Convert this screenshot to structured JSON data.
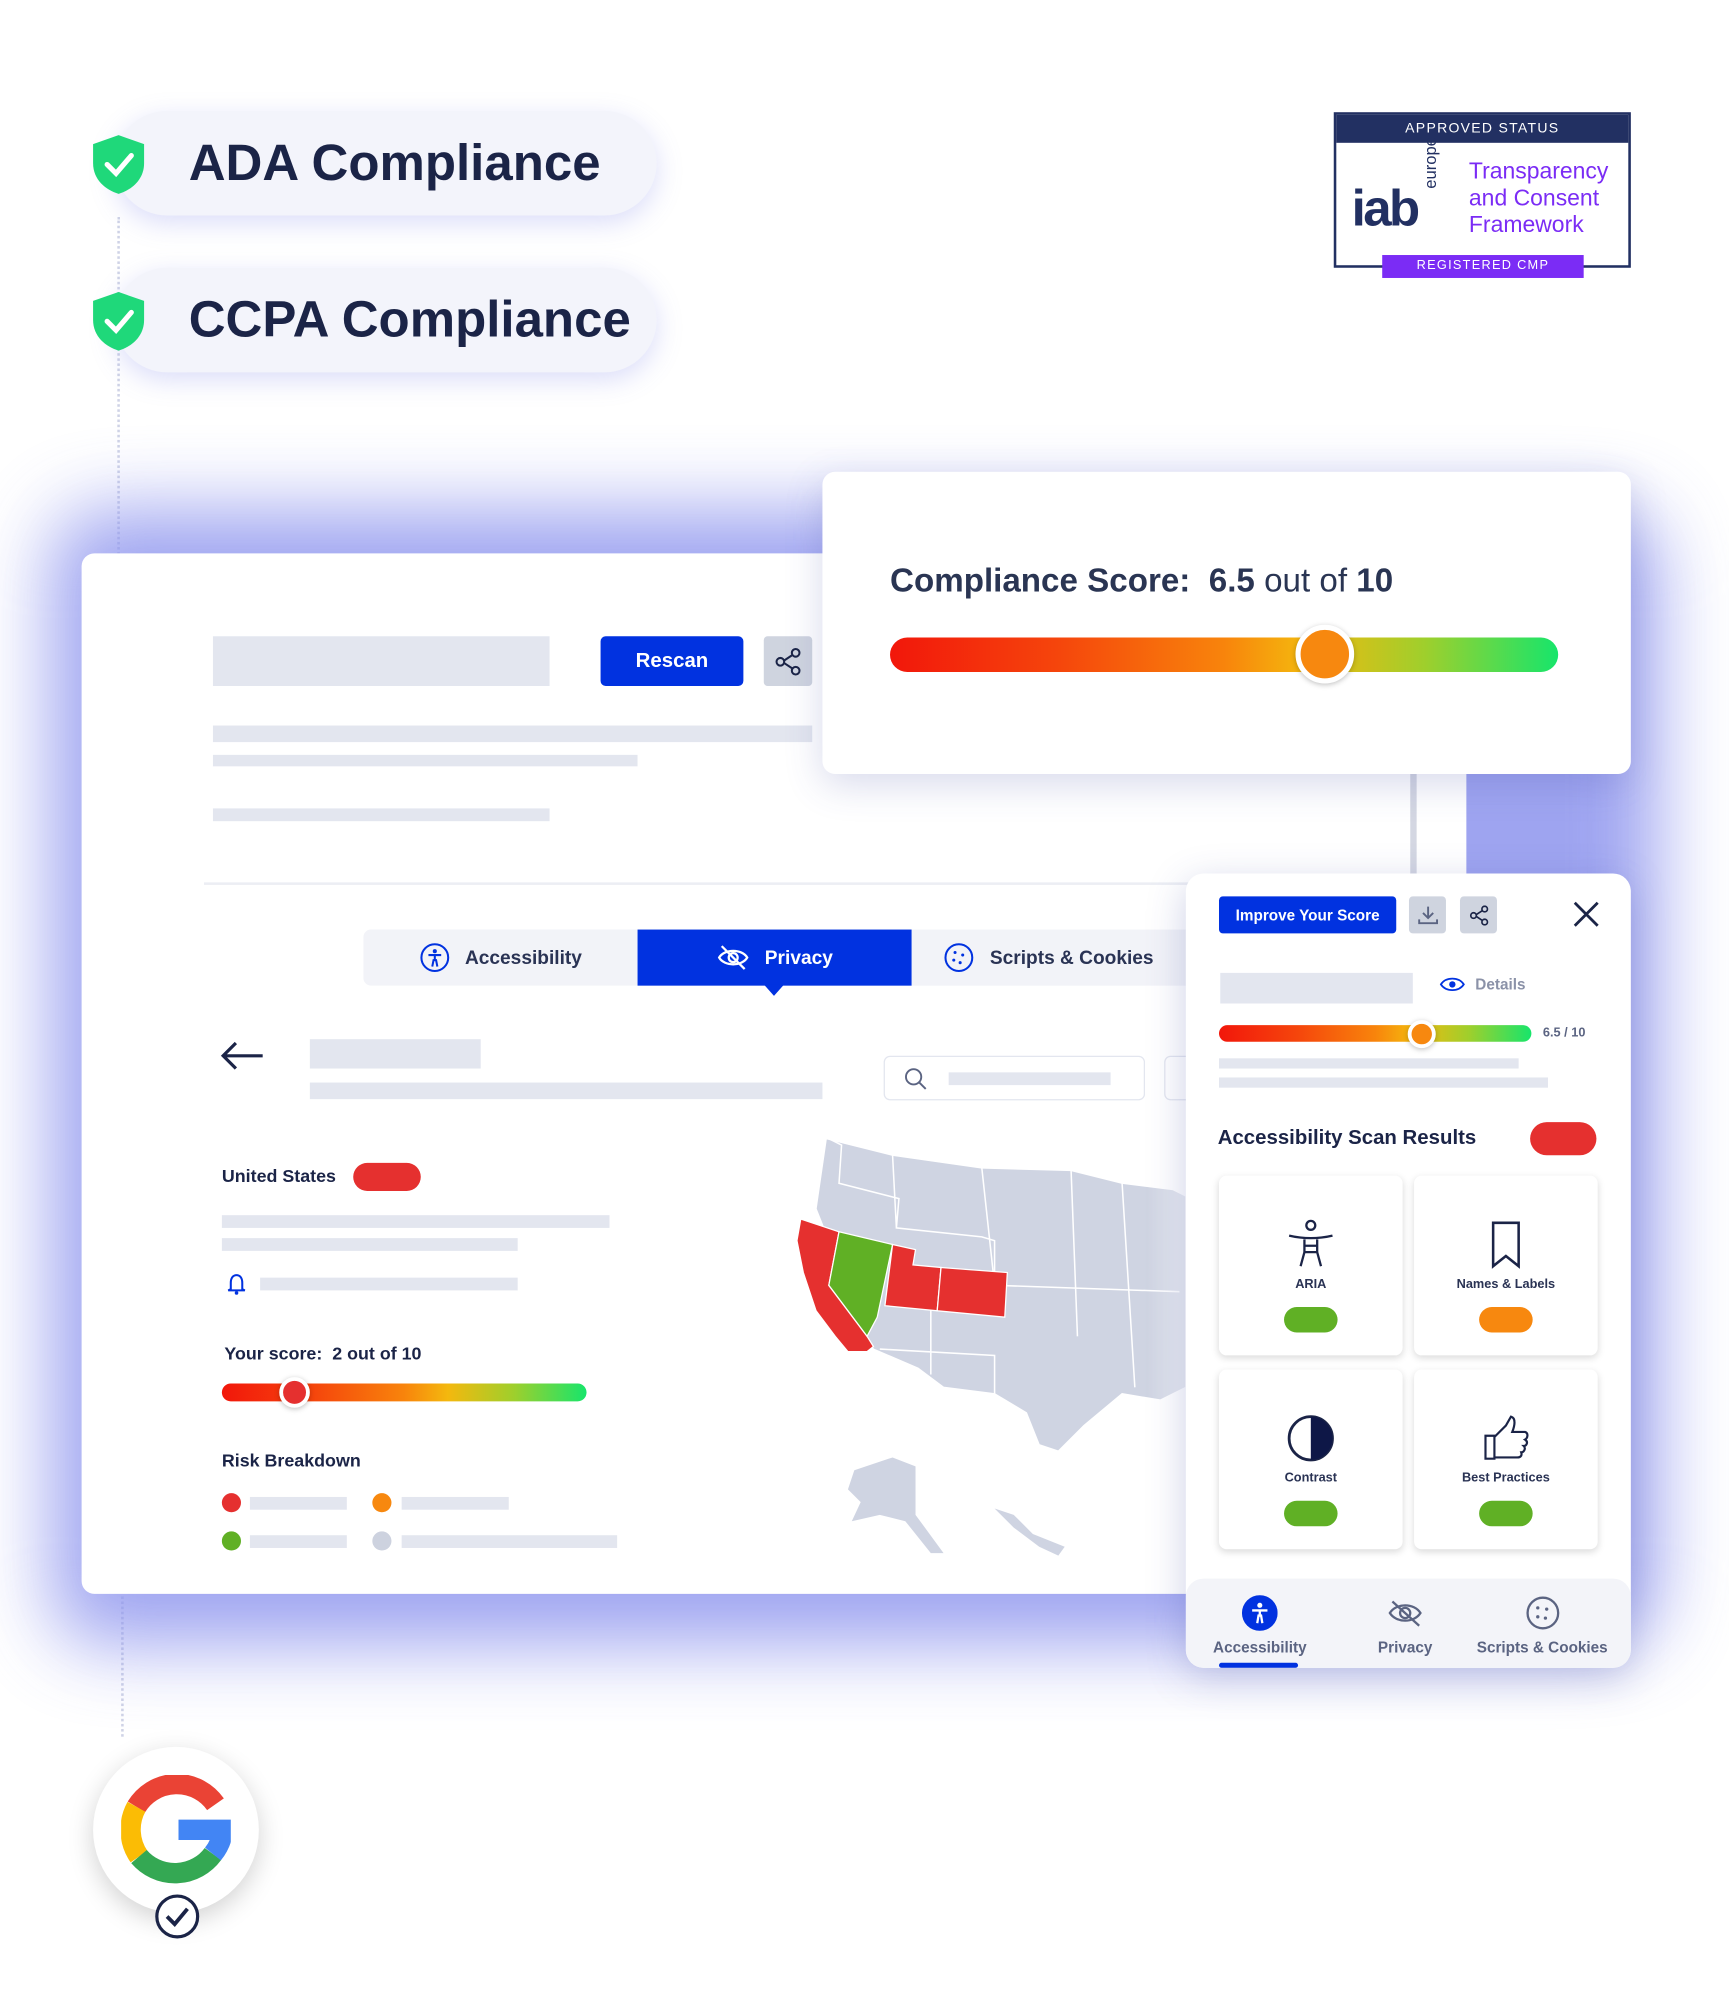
{
  "badges": [
    {
      "label": "ADA Compliance",
      "icon": "shield-check-icon"
    },
    {
      "label": "CCPA Compliance",
      "icon": "shield-check-icon"
    }
  ],
  "iab": {
    "top": "APPROVED STATUS",
    "logo": "iab",
    "logo_sub": "europe",
    "line1": "Transparency",
    "line2": "and Consent",
    "line3": "Framework",
    "bottom": "REGISTERED CMP"
  },
  "compliance": {
    "label": "Compliance Score:",
    "score": "6.5",
    "out_of": "out of",
    "max": "10",
    "value": 6.5
  },
  "main": {
    "rescan": "Rescan",
    "tabs": [
      {
        "label": "Accessibility",
        "icon": "accessibility-icon"
      },
      {
        "label": "Privacy",
        "icon": "eye-slash-icon",
        "active": true
      },
      {
        "label": "Scripts & Cookies",
        "icon": "cookie-icon"
      }
    ],
    "region": "United States",
    "region_status_color": "#e5302f",
    "your_score_label": "Your score:",
    "your_score": "2 out of 10",
    "your_score_value": 2,
    "risk_title": "Risk Breakdown",
    "risk_colors": [
      "#e5302f",
      "#f7880f",
      "#60b025",
      "#cdd2df"
    ],
    "map_highlight": {
      "red": [
        "California",
        "Utah",
        "Colorado"
      ],
      "green": [
        "Nevada"
      ]
    }
  },
  "panel": {
    "improve": "Improve Your Score",
    "details": "Details",
    "score_text": "6.5 / 10",
    "score_value": 6.5,
    "section_title": "Accessibility Scan Results",
    "cards": [
      {
        "label": "ARIA",
        "icon": "accessibility-figure-icon",
        "status": "#60b025"
      },
      {
        "label": "Names & Labels",
        "icon": "bookmark-icon",
        "status": "#f7880f"
      },
      {
        "label": "Contrast",
        "icon": "contrast-icon",
        "status": "#60b025"
      },
      {
        "label": "Best Practices",
        "icon": "thumbs-up-icon",
        "status": "#60b025"
      }
    ],
    "nav": [
      {
        "label": "Accessibility",
        "active": true
      },
      {
        "label": "Privacy"
      },
      {
        "label": "Scripts & Cookies"
      }
    ]
  },
  "colors": {
    "brand": "#0132e0",
    "navy": "#1b2447",
    "iab_purple": "#7b2cf5"
  }
}
